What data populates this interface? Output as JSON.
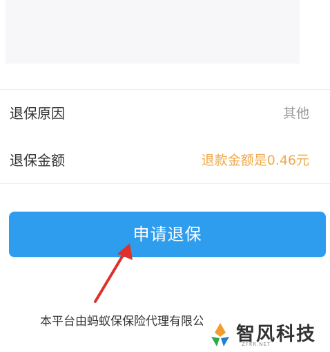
{
  "form": {
    "reason_label": "退保原因",
    "reason_value": "其他",
    "amount_label": "退保金额",
    "amount_value": "退款金额是0.46元"
  },
  "actions": {
    "apply_label": "申请退保"
  },
  "footer": {
    "note": "本平台由蚂蚁保保险代理有限公司管理并运营"
  },
  "watermark": {
    "title": "智风科技",
    "subtitle": "ZFKR.NET"
  },
  "colors": {
    "button": "#2f9dee",
    "amount": "#f0a94a",
    "arrow": "#e0302a"
  }
}
